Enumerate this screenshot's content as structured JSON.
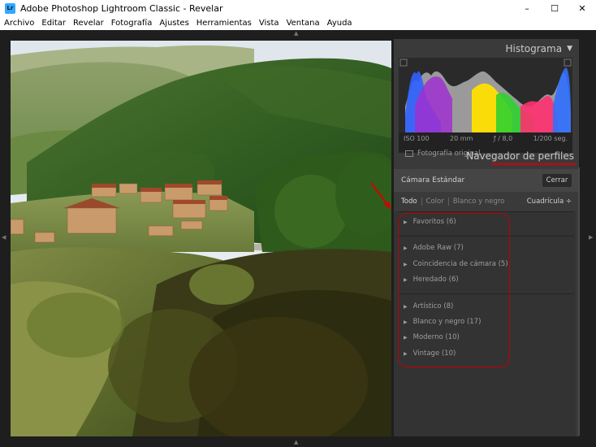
{
  "window": {
    "app_icon_text": "Lr",
    "title": "Adobe Photoshop Lightroom Classic - Revelar",
    "controls": [
      "–",
      "☐",
      "✕"
    ]
  },
  "menu": [
    "Archivo",
    "Editar",
    "Revelar",
    "Fotografía",
    "Ajustes",
    "Herramientas",
    "Vista",
    "Ventana",
    "Ayuda"
  ],
  "histogram": {
    "title": "Histograma",
    "collapse_glyph": "▼",
    "iso": "ISO 100",
    "focal": "20 mm",
    "aperture": "ƒ / 8,0",
    "shutter": "1/200 seg.",
    "original_label": "Fotografía original"
  },
  "profile_browser": {
    "title": "Navegador de perfiles",
    "current_profile": "Cámara Estándar",
    "close_label": "Cerrar",
    "filters": [
      "Todo",
      "Color",
      "Blanco y negro"
    ],
    "view_label": "Cuadrícula ÷",
    "groups": [
      [
        "Favoritos (6)"
      ],
      [
        "Adobe Raw (7)",
        "Coincidencia de cámara (5)",
        "Heredado (6)"
      ],
      [
        "Artístico (8)",
        "Blanco y negro (17)",
        "Moderno (10)",
        "Vintage (10)"
      ]
    ]
  },
  "annotation_color": "#c00000"
}
